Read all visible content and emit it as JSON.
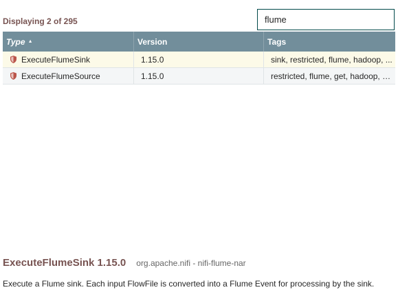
{
  "summary": {
    "displaying": "Displaying 2 of 295"
  },
  "filter": {
    "value": "flume",
    "placeholder": ""
  },
  "table": {
    "columns": [
      {
        "label": "Type",
        "sorted": "ascending"
      },
      {
        "label": "Version"
      },
      {
        "label": "Tags"
      }
    ],
    "rows": [
      {
        "type": "ExecuteFlumeSink",
        "version": "1.15.0",
        "tags": "sink, restricted, flume, hadoop, ...",
        "restricted_icon": "shield-icon",
        "selected": true
      },
      {
        "type": "ExecuteFlumeSource",
        "version": "1.15.0",
        "tags": "restricted, flume, get, hadoop, s...",
        "restricted_icon": "shield-icon",
        "selected": false
      }
    ]
  },
  "details": {
    "name": "ExecuteFlumeSink 1.15.0",
    "bundle": "org.apache.nifi - nifi-flume-nar",
    "description": "Execute a Flume sink. Each input FlowFile is converted into a Flume Event for processing by the sink."
  },
  "colors": {
    "header_bg": "#728e9b",
    "accent_text": "#775351",
    "selected_row": "#fcfae8",
    "restricted_icon": "#ba554a"
  }
}
